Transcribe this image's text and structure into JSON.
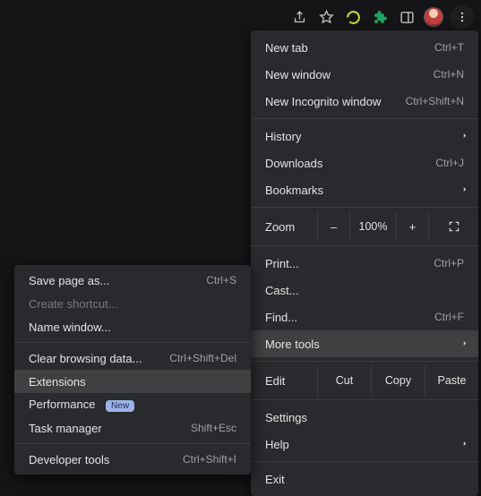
{
  "toolbar": {
    "share": "Share",
    "bookmark": "Bookmark",
    "reload": "Reload",
    "extensions": "Extensions",
    "sidepanel": "Side panel",
    "profile": "Profile",
    "menu": "Customize"
  },
  "menu": {
    "new_tab": {
      "label": "New tab",
      "shortcut": "Ctrl+T"
    },
    "new_window": {
      "label": "New window",
      "shortcut": "Ctrl+N"
    },
    "new_incognito": {
      "label": "New Incognito window",
      "shortcut": "Ctrl+Shift+N"
    },
    "history": {
      "label": "History"
    },
    "downloads": {
      "label": "Downloads",
      "shortcut": "Ctrl+J"
    },
    "bookmarks": {
      "label": "Bookmarks"
    },
    "zoom": {
      "label": "Zoom",
      "minus": "–",
      "pct": "100%",
      "plus": "+"
    },
    "print": {
      "label": "Print...",
      "shortcut": "Ctrl+P"
    },
    "cast": {
      "label": "Cast..."
    },
    "find": {
      "label": "Find...",
      "shortcut": "Ctrl+F"
    },
    "more_tools": {
      "label": "More tools"
    },
    "edit": {
      "label": "Edit",
      "cut": "Cut",
      "copy": "Copy",
      "paste": "Paste"
    },
    "settings": {
      "label": "Settings"
    },
    "help": {
      "label": "Help"
    },
    "exit": {
      "label": "Exit"
    }
  },
  "submenu": {
    "save_page": {
      "label": "Save page as...",
      "shortcut": "Ctrl+S"
    },
    "create_shortcut": {
      "label": "Create shortcut..."
    },
    "name_window": {
      "label": "Name window..."
    },
    "clear_browsing": {
      "label": "Clear browsing data...",
      "shortcut": "Ctrl+Shift+Del"
    },
    "extensions": {
      "label": "Extensions"
    },
    "performance": {
      "label": "Performance",
      "badge": "New"
    },
    "task_manager": {
      "label": "Task manager",
      "shortcut": "Shift+Esc"
    },
    "developer_tools": {
      "label": "Developer tools",
      "shortcut": "Ctrl+Shift+I"
    }
  }
}
